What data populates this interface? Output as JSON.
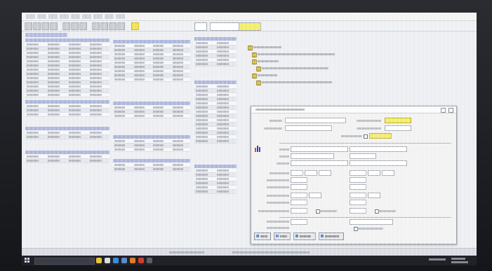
{
  "menubar": {
    "items": [
      "",
      "",
      "",
      "",
      "",
      "",
      "",
      "",
      ""
    ]
  },
  "toolbar": {
    "combo1": "",
    "combo2": ""
  },
  "left_panels": {
    "main_table": {
      "title": "",
      "headers": [
        "",
        "",
        "",
        ""
      ],
      "rows": 13
    },
    "secondary_tables": [
      {
        "headers": [
          "",
          "",
          "",
          ""
        ],
        "rows": 3
      },
      {
        "headers": [
          "",
          "",
          "",
          ""
        ],
        "rows": 2
      },
      {
        "headers": [
          "",
          "",
          "",
          ""
        ],
        "rows": 2
      }
    ]
  },
  "middle_panels": {
    "tables": [
      {
        "headers": [
          "",
          "",
          "",
          ""
        ],
        "rows": 9
      },
      {
        "headers": [
          "",
          "",
          "",
          ""
        ],
        "rows": 3
      },
      {
        "headers": [
          "",
          "",
          "",
          ""
        ],
        "rows": 3
      },
      {
        "headers": [
          "",
          "",
          "",
          ""
        ],
        "rows": 2
      }
    ]
  },
  "right_panels": {
    "tables": [
      {
        "headers": [
          "",
          ""
        ],
        "rows": 6
      },
      {
        "headers": [
          "",
          ""
        ],
        "rows": 14
      },
      {
        "headers": [
          "",
          ""
        ],
        "rows": 6
      }
    ]
  },
  "tree": {
    "nodes": [
      "",
      "",
      "",
      "",
      "",
      ""
    ]
  },
  "dialog": {
    "title": "",
    "buttons": [
      "",
      "",
      "",
      ""
    ],
    "fields": {
      "top": "",
      "yellow_field": ""
    }
  },
  "statusbar": {
    "left": "",
    "right": ""
  },
  "taskbar": {
    "search_placeholder": "",
    "clock_time": "",
    "clock_date": ""
  },
  "colors": {
    "accent_yellow": "#f2ec6a",
    "header_blue": "#aeb7dc",
    "taskbar": "#202228"
  }
}
